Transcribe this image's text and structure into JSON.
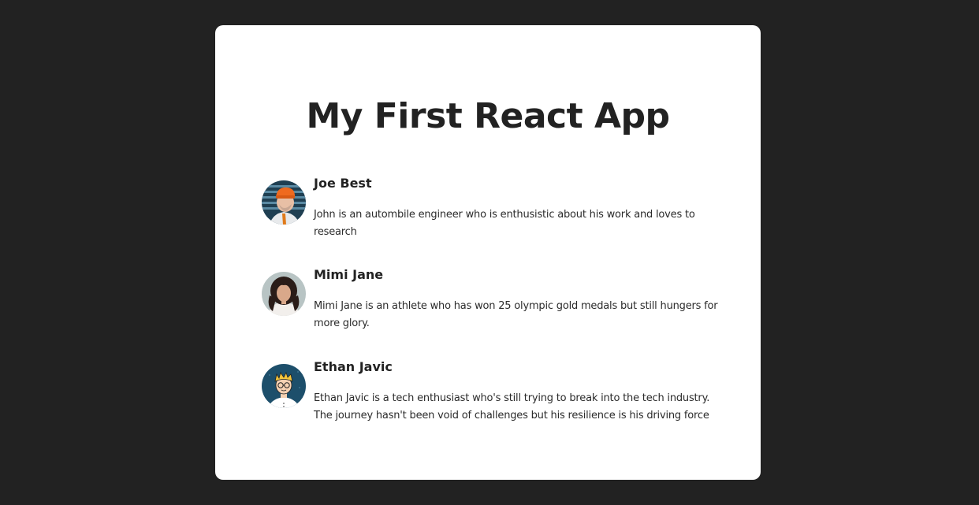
{
  "app": {
    "title": "My First React App"
  },
  "people": [
    {
      "name": "Joe Best",
      "description": "John is an autombile engineer who is enthusistic about his work and loves to research",
      "avatar_icon": "man-orange-beanie-photo"
    },
    {
      "name": "Mimi Jane",
      "description": "Mimi Jane is an athlete who has won 25 olympic gold medals but still hungers for more glory.",
      "avatar_icon": "woman-curly-hair-photo"
    },
    {
      "name": "Ethan Javic",
      "description": "Ethan Javic is a tech enthusiast who's still trying to break into the tech industry. The journey hasn't been void of challenges but his resilience is his driving force",
      "avatar_icon": "cartoon-boy-glasses-illustration"
    }
  ],
  "colors": {
    "page_background": "#222222",
    "card_background": "#ffffff",
    "text": "#222222"
  }
}
